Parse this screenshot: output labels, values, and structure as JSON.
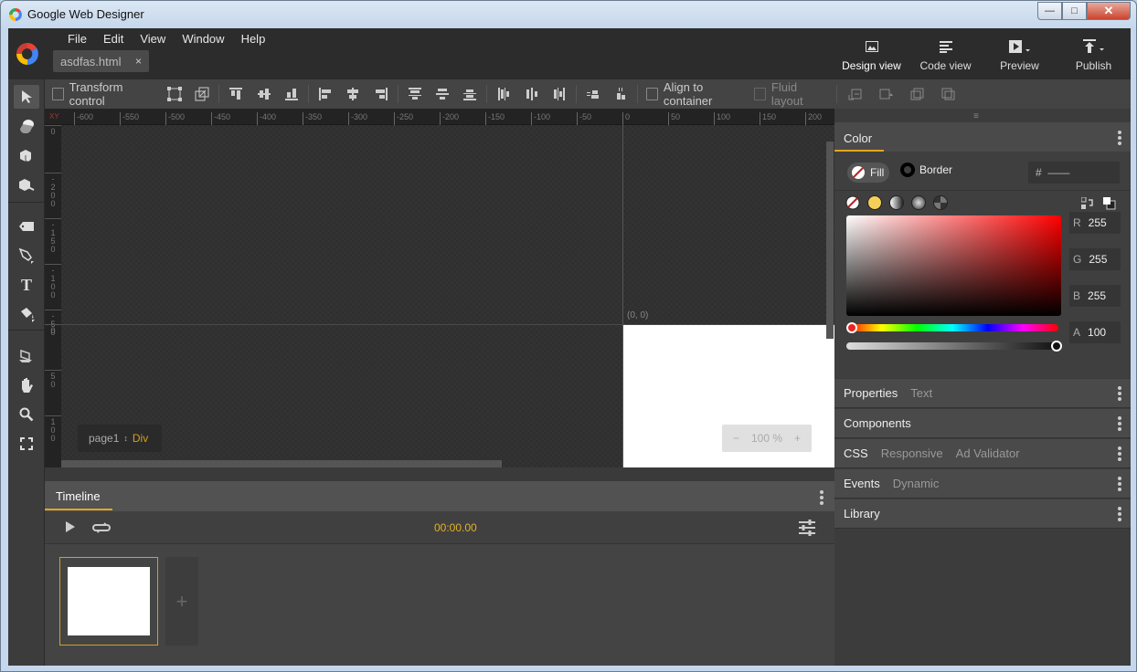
{
  "window": {
    "title": "Google Web Designer",
    "controls": {
      "minimize": "—",
      "maximize": "□",
      "close": "✕"
    }
  },
  "menu": [
    "File",
    "Edit",
    "View",
    "Window",
    "Help"
  ],
  "file_tab": {
    "name": "asdfas.html",
    "close": "×"
  },
  "views": [
    {
      "label": "Design view",
      "icon": "image-icon",
      "active": true
    },
    {
      "label": "Code view",
      "icon": "code-lines-icon",
      "active": false
    },
    {
      "label": "Preview",
      "icon": "play-dropdown-icon",
      "active": false
    },
    {
      "label": "Publish",
      "icon": "publish-dropdown-icon",
      "active": false
    }
  ],
  "toolbar": {
    "transform_control": "Transform control",
    "align_to_container": "Align to container",
    "fluid_layout": "Fluid layout"
  },
  "tools": [
    "selection",
    "3d-rotation",
    "3d-object-rotate",
    "3d-translation",
    "tag",
    "pen",
    "text",
    "fill",
    "shape-3d",
    "hand",
    "zoom",
    "fit-screen"
  ],
  "ruler": {
    "corner": "XY",
    "h_ticks": [
      "-600",
      "-550",
      "-500",
      "-450",
      "-400",
      "-350",
      "-300",
      "-250",
      "-200",
      "-150",
      "-100",
      "-50",
      "0",
      "50",
      "100",
      "150",
      "200"
    ],
    "v_ticks": [
      "0",
      "-200",
      "-150",
      "-100",
      "-50",
      "0",
      "50",
      "100"
    ]
  },
  "stage": {
    "origin_label": "(0, 0)",
    "breadcrumb_page": "page1",
    "breadcrumb_element": "Div",
    "zoom": {
      "minus": "−",
      "value": "100 %",
      "plus": "+"
    }
  },
  "timeline": {
    "tab": "Timeline",
    "time": "00:00.00",
    "add": "+"
  },
  "color_panel": {
    "title": "Color",
    "fill": "Fill",
    "border": "Border",
    "hex_prefix": "#",
    "hex_value": "——",
    "r_label": "R",
    "r": "255",
    "g_label": "G",
    "g": "255",
    "b_label": "B",
    "b": "255",
    "a_label": "A",
    "a": "100",
    "accent": "#e3a61b"
  },
  "panels": [
    {
      "main": "Properties",
      "subs": [
        "Text"
      ]
    },
    {
      "main": "Components",
      "subs": []
    },
    {
      "main": "CSS",
      "subs": [
        "Responsive",
        "Ad Validator"
      ]
    },
    {
      "main": "Events",
      "subs": [
        "Dynamic"
      ]
    },
    {
      "main": "Library",
      "subs": []
    }
  ]
}
